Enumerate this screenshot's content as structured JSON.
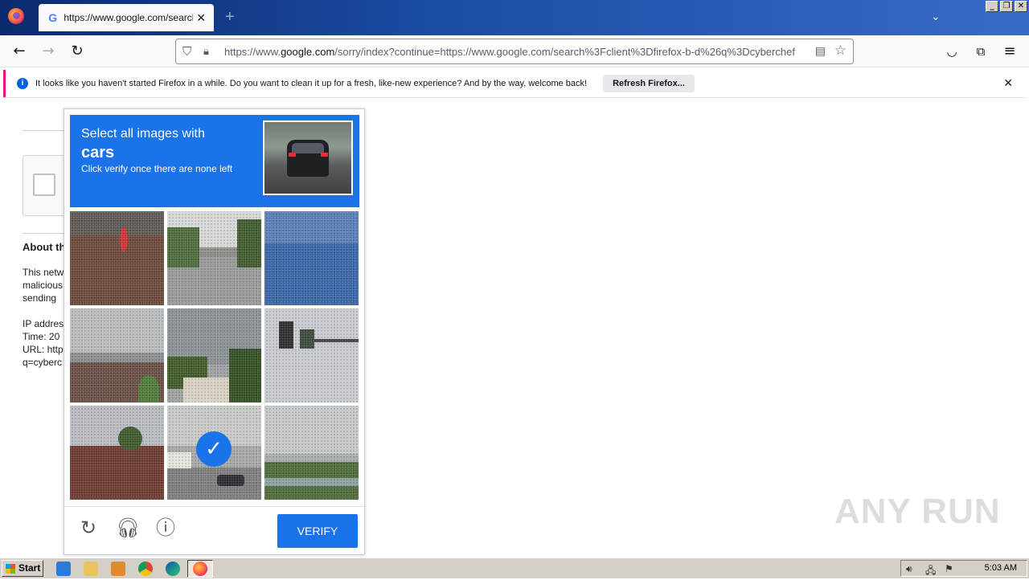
{
  "browser": {
    "tab_title": "https://www.google.com/search?c",
    "url_prefix": "https://www.",
    "url_domain": "google.com",
    "url_rest": "/sorry/index?continue=https://www.google.com/search%3Fclient%3Dfirefox-b-d%26q%3Dcyberchef"
  },
  "notification": {
    "message": "It looks like you haven't started Firefox in a while. Do you want to clean it up for a fresh, like-new experience? And by the way, welcome back!",
    "button": "Refresh Firefox..."
  },
  "page": {
    "heading": "About this page",
    "lines": [
      "This network",
      "malicious",
      "sending",
      "IP address",
      "Time: 20",
      "URL: http",
      "q=cyberc"
    ]
  },
  "captcha": {
    "prompt_line1": "Select all images with",
    "target": "cars",
    "prompt_line3": "Click verify once there are none left",
    "verify_label": "VERIFY",
    "selected_tile_index": 7
  },
  "watermark": "ANY RUN",
  "taskbar": {
    "start_label": "Start",
    "clock": "5:03 AM"
  },
  "colors": {
    "captcha_blue": "#1a73e8",
    "notification_accent": "#e31587"
  }
}
